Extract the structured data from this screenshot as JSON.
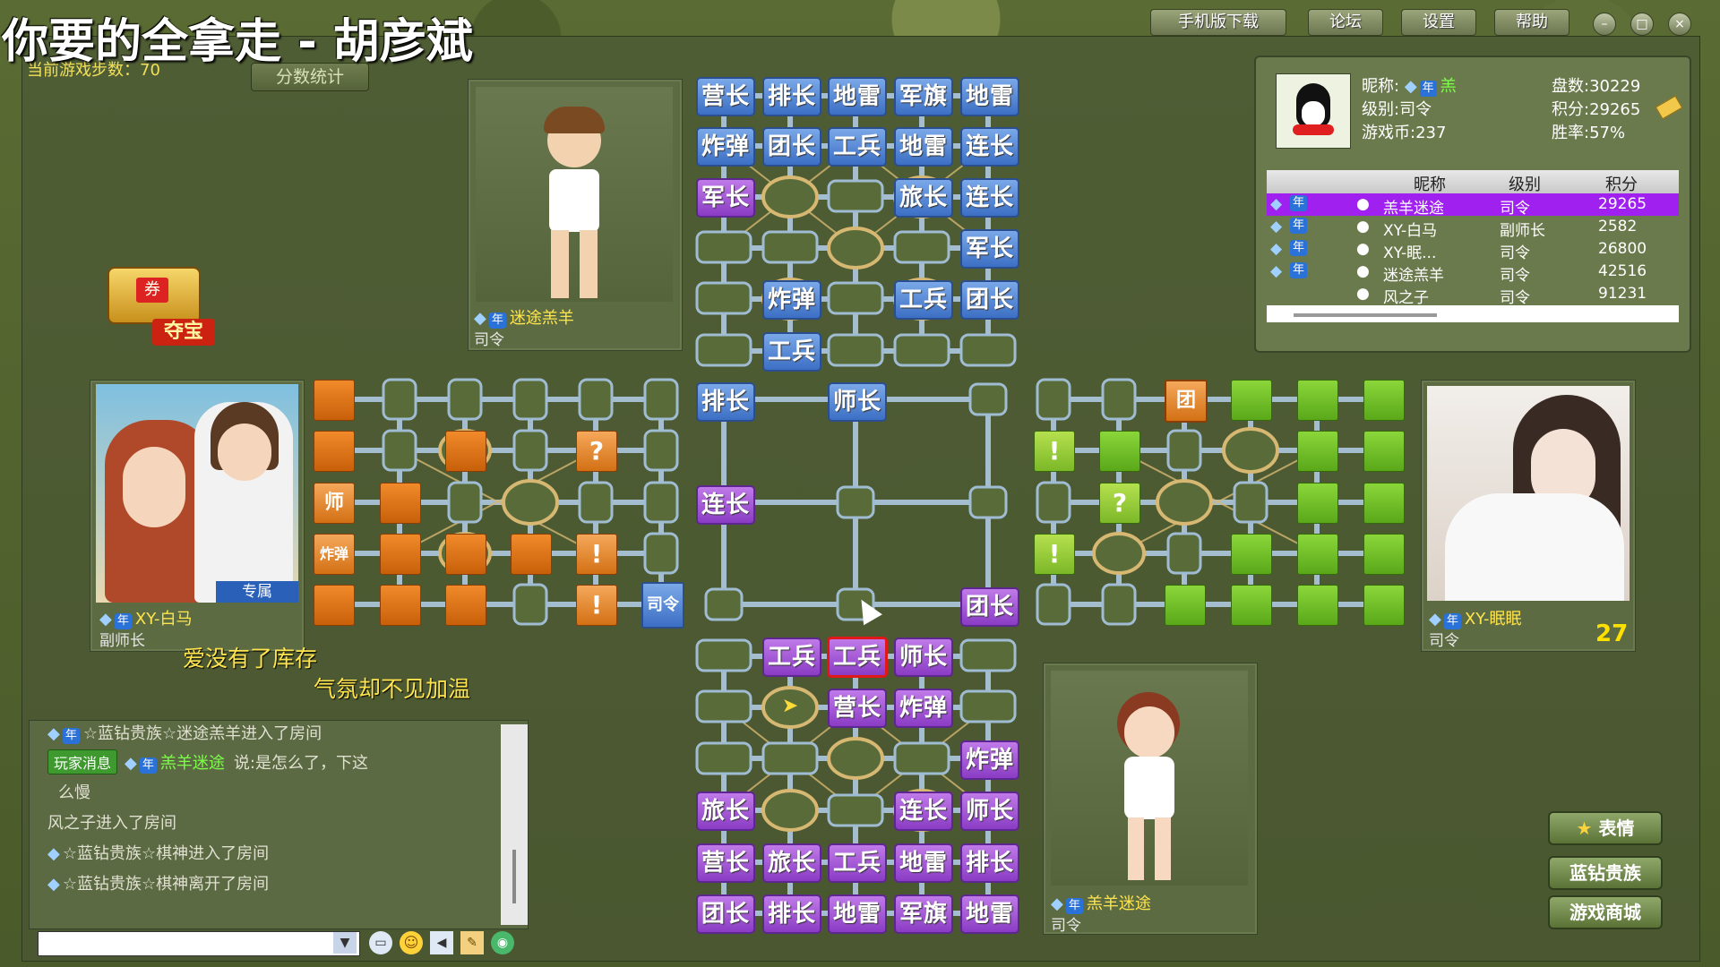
{
  "overlay_title": "你要的全拿走 - 胡彦斌",
  "window_buttons": [
    "手机版下载",
    "论坛",
    "设置",
    "帮助"
  ],
  "game": {
    "steps_label": "当前游戏步数：",
    "steps": "70",
    "score_button": "分数统计",
    "treasure_label": "夺宝",
    "treasure_badge": "券"
  },
  "players": {
    "top": {
      "name": "迷途羔羊",
      "rank": "司令",
      "vip": "年"
    },
    "left": {
      "name": "XY-白马",
      "rank": "副师长",
      "vip": "年",
      "tag": "专属"
    },
    "right": {
      "name": "XY-眠眠",
      "rank": "司令",
      "vip": "年",
      "timer": "27"
    },
    "bottom": {
      "name": "羔羊迷途",
      "rank": "司令",
      "vip": "年"
    }
  },
  "speech": [
    "爱没有了库存",
    "气氛却不见加温"
  ],
  "profile": {
    "nickname_label": "昵称:",
    "nickname": "羔",
    "level_label": "级别:",
    "level": "司令",
    "coins_label": "游戏币:",
    "coins": "237",
    "games_label": "盘数:",
    "games": "30229",
    "points_label": "积分:",
    "points": "29265",
    "winrate_label": "胜率:",
    "winrate": "57%"
  },
  "player_table": {
    "headers": [
      "昵称",
      "级别",
      "积分"
    ],
    "rows": [
      {
        "name": "羔羊迷途",
        "rank": "司令",
        "score": "29265",
        "selected": true
      },
      {
        "name": "XY-白马",
        "rank": "副师长",
        "score": "2582",
        "selected": false
      },
      {
        "name": "XY-眠...",
        "rank": "司令",
        "score": "26800",
        "selected": false
      },
      {
        "name": "迷途羔羊",
        "rank": "司令",
        "score": "42516",
        "selected": false
      },
      {
        "name": "风之子",
        "rank": "司令",
        "score": "91231",
        "selected": false
      }
    ]
  },
  "chat": {
    "lines": [
      "☆蓝钻贵族☆迷途羔羊进入了房间",
      "说:是怎么了，下这",
      "么慢",
      "风之子进入了房间",
      "☆蓝钻贵族☆棋神进入了房间",
      "☆蓝钻贵族☆棋神离开了房间"
    ],
    "player_msg_tag": "玩家消息",
    "player_msg_name": "羔羊迷途",
    "input_value": ""
  },
  "side_buttons": [
    "表情",
    "蓝钻贵族",
    "游戏商城"
  ],
  "board": {
    "top_pieces": [
      "营长",
      "排长",
      "地雷",
      "军旗",
      "地雷",
      "炸弹",
      "团长",
      "工兵",
      "地雷",
      "连长",
      "军长",
      "旅长",
      "连长",
      "军长",
      "炸弹",
      "工兵",
      "团长",
      "工兵"
    ],
    "center_pieces": [
      "排长",
      "师长",
      "连长",
      "团长"
    ],
    "bottom_pieces": [
      "工兵",
      "工兵",
      "师长",
      "营长",
      "炸弹",
      "炸弹",
      "旅长",
      "连长",
      "师长",
      "营长",
      "旅长",
      "工兵",
      "地雷",
      "排长",
      "团长",
      "排长",
      "地雷",
      "军旗",
      "地雷"
    ],
    "left_marked": [
      "师",
      "炸弹",
      "?",
      "!",
      "!",
      "司令"
    ],
    "right_marked": [
      "团",
      "!",
      "?",
      "!"
    ]
  },
  "colors": {
    "blue_piece": "#3c6fc4",
    "purple_piece": "#8a3cc4",
    "orange_piece": "#e07a1a",
    "green_piece": "#6cbf26",
    "highlight": "#a020f0"
  }
}
